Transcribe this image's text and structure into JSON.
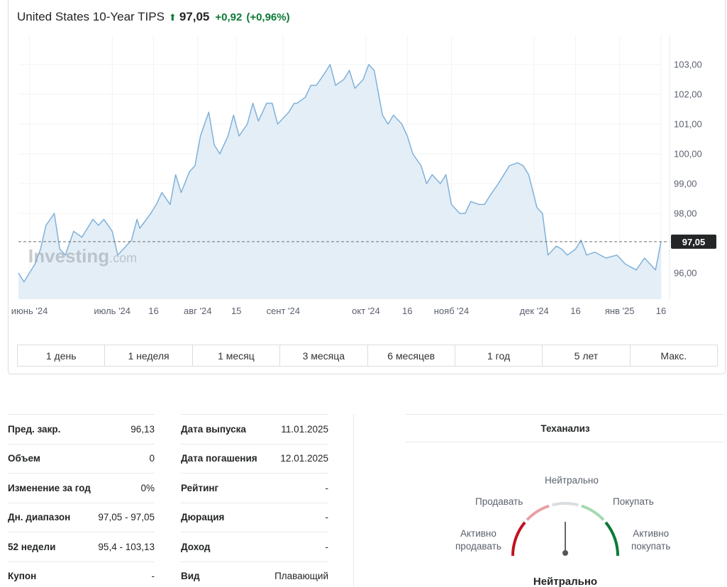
{
  "header": {
    "title": "United States 10-Year TIPS",
    "arrow": "⬆",
    "price": "97,05",
    "change": "+0,92",
    "change_pct": "(+0,96%)"
  },
  "chart_data": {
    "type": "area",
    "y_ticks": [
      "103,00",
      "102,00",
      "101,00",
      "100,00",
      "99,00",
      "98,00",
      "96,00"
    ],
    "y_tick_values": [
      103,
      102,
      101,
      100,
      99,
      98,
      96
    ],
    "x_ticks": [
      "июнь '24",
      "июль '24",
      "16",
      "авг '24",
      "15",
      "сент '24",
      "окт '24",
      "16",
      "нояб '24",
      "дек '24",
      "16",
      "янв '25",
      "16"
    ],
    "x_tick_dates": [
      "2024-06-01",
      "2024-07-01",
      "2024-07-16",
      "2024-08-01",
      "2024-08-15",
      "2024-09-01",
      "2024-10-01",
      "2024-10-16",
      "2024-11-01",
      "2024-12-01",
      "2024-12-16",
      "2025-01-01",
      "2025-01-16"
    ],
    "current_value": "97,05",
    "current_line": 97.05,
    "ylim": [
      95.0,
      103.5
    ],
    "watermark": "Investing",
    "watermark_suffix": ".com",
    "colors": {
      "line": "#7fb1d9",
      "fill": "#e4eef7",
      "price_tag": "#232526"
    },
    "series": [
      {
        "x": [
          "2024-05-28",
          "2024-05-30",
          "2024-06-03",
          "2024-06-05",
          "2024-06-07",
          "2024-06-10",
          "2024-06-12",
          "2024-06-14",
          "2024-06-17",
          "2024-06-20",
          "2024-06-24",
          "2024-06-26",
          "2024-06-28",
          "2024-07-01",
          "2024-07-03",
          "2024-07-05",
          "2024-07-08",
          "2024-07-10",
          "2024-07-11",
          "2024-07-15",
          "2024-07-17",
          "2024-07-19",
          "2024-07-22",
          "2024-07-24",
          "2024-07-26",
          "2024-07-29",
          "2024-07-31",
          "2024-08-02",
          "2024-08-05",
          "2024-08-07",
          "2024-08-09",
          "2024-08-12",
          "2024-08-14",
          "2024-08-16",
          "2024-08-19",
          "2024-08-21",
          "2024-08-23",
          "2024-08-26",
          "2024-08-28",
          "2024-08-30",
          "2024-09-03",
          "2024-09-05",
          "2024-09-06",
          "2024-09-09",
          "2024-09-11",
          "2024-09-13",
          "2024-09-16",
          "2024-09-18",
          "2024-09-20",
          "2024-09-23",
          "2024-09-25",
          "2024-09-27",
          "2024-09-30",
          "2024-10-02",
          "2024-10-04",
          "2024-10-07",
          "2024-10-09",
          "2024-10-11",
          "2024-10-14",
          "2024-10-16",
          "2024-10-18",
          "2024-10-21",
          "2024-10-23",
          "2024-10-25",
          "2024-10-28",
          "2024-10-30",
          "2024-11-01",
          "2024-11-04",
          "2024-11-06",
          "2024-11-08",
          "2024-11-11",
          "2024-11-13",
          "2024-11-15",
          "2024-11-18",
          "2024-11-20",
          "2024-11-22",
          "2024-11-25",
          "2024-11-27",
          "2024-11-29",
          "2024-12-02",
          "2024-12-04",
          "2024-12-06",
          "2024-12-09",
          "2024-12-11",
          "2024-12-13",
          "2024-12-16",
          "2024-12-18",
          "2024-12-20",
          "2024-12-23",
          "2024-12-27",
          "2024-12-31",
          "2025-01-03",
          "2025-01-07",
          "2025-01-10",
          "2025-01-14",
          "2025-01-16"
        ],
        "y": [
          96.0,
          95.7,
          96.3,
          96.8,
          97.6,
          98.0,
          96.8,
          96.6,
          97.4,
          97.2,
          97.8,
          97.6,
          97.8,
          97.4,
          96.6,
          96.8,
          97.1,
          97.8,
          97.5,
          98.0,
          98.3,
          98.7,
          98.3,
          99.3,
          98.7,
          99.4,
          99.6,
          100.6,
          101.4,
          100.3,
          100.0,
          100.6,
          101.3,
          100.6,
          101.0,
          101.7,
          101.1,
          101.7,
          101.7,
          101.0,
          101.4,
          101.7,
          101.7,
          101.9,
          102.3,
          102.3,
          102.7,
          103.0,
          102.3,
          102.5,
          102.8,
          102.2,
          102.5,
          103.0,
          102.8,
          101.3,
          101.0,
          101.3,
          101.0,
          100.6,
          100.0,
          99.6,
          99.0,
          99.3,
          99.0,
          99.3,
          98.3,
          98.0,
          98.0,
          98.4,
          98.3,
          98.3,
          98.6,
          99.0,
          99.3,
          99.6,
          99.7,
          99.6,
          99.3,
          98.2,
          98.0,
          96.6,
          96.9,
          96.8,
          96.6,
          96.8,
          97.1,
          96.6,
          96.7,
          96.5,
          96.6,
          96.3,
          96.1,
          96.5,
          96.1,
          97.05
        ]
      }
    ]
  },
  "range_buttons": [
    "1 день",
    "1 неделя",
    "1 месяц",
    "3 месяца",
    "6 месяцев",
    "1 год",
    "5 лет",
    "Макс."
  ],
  "stats_left": [
    {
      "label": "Пред. закр.",
      "value": "96,13"
    },
    {
      "label": "Объем",
      "value": "0"
    },
    {
      "label": "Изменение за год",
      "value": "0%"
    },
    {
      "label": "Дн. диапазон",
      "value": "97,05 - 97,05"
    },
    {
      "label": "52 недели",
      "value": "95,4 - 103,13"
    },
    {
      "label": "Купон",
      "value": "-"
    }
  ],
  "stats_right": [
    {
      "label": "Дата выпуска",
      "value": "11.01.2025"
    },
    {
      "label": "Дата погашения",
      "value": "12.01.2025"
    },
    {
      "label": "Рейтинг",
      "value": "-"
    },
    {
      "label": "Дюрация",
      "value": "-"
    },
    {
      "label": "Доход",
      "value": "-"
    },
    {
      "label": "Вид",
      "value": "Плавающий"
    }
  ],
  "tech": {
    "title": "Теханализ",
    "labels": {
      "neutral": "Нейтрально",
      "sell": "Продавать",
      "buy": "Покупать",
      "strong_sell_1": "Активно",
      "strong_sell_2": "продавать",
      "strong_buy_1": "Активно",
      "strong_buy_2": "покупать"
    },
    "result": "Нейтрально",
    "colors": {
      "strong_sell": "#c1121f",
      "sell": "#e8a0a4",
      "neutral": "#dadde0",
      "buy": "#a3d9b1",
      "strong_buy": "#0a7a36"
    }
  }
}
